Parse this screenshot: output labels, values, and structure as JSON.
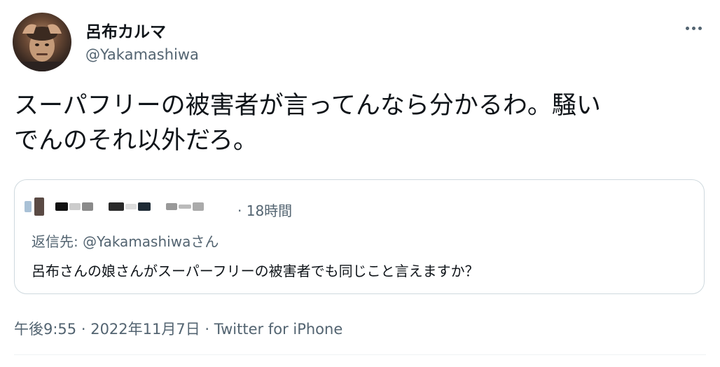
{
  "author": {
    "display_name": "呂布カルマ",
    "handle": "@Yakamashiwa"
  },
  "tweet": {
    "text_line1": "スーパフリーの被害者が言ってんなら分かるわ。騒い",
    "text_line2": "でんのそれ以外だろ。"
  },
  "quoted_tweet": {
    "time_ago": "· 18時間",
    "reply_prefix": "返信先: ",
    "reply_mention": "@Yakamashiwa",
    "reply_suffix": "さん",
    "text": "呂布さんの娘さんがスーパーフリーの被害者でも同じこと言えますか？"
  },
  "meta": {
    "time": "午後9:55",
    "sep1": " · ",
    "date": "2022年11月7日",
    "sep2": " · ",
    "source": "Twitter for iPhone"
  },
  "icons": {
    "more": "more-horizontal-icon"
  },
  "colors": {
    "text": "#0f1419",
    "secondary": "#536471",
    "border": "#cfd9de"
  }
}
